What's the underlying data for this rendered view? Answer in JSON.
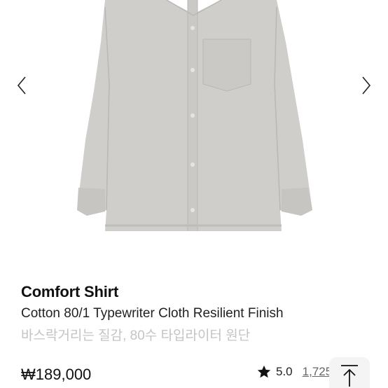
{
  "gallery": {
    "prev_icon": "chevron-left-icon",
    "next_icon": "chevron-right-icon",
    "image_alt": "grey shirt"
  },
  "product": {
    "name": "Comfort Shirt",
    "subtitle": "Cotton 80/1 Typewriter Cloth Resilient Finish",
    "description_kr": "바스락거리는 질감, 80수 타입라이터 원단",
    "price": "₩189,000"
  },
  "rating": {
    "score": "5.0",
    "review_count": "1,725",
    "icon": "star-icon"
  },
  "controls": {
    "scroll_top_icon": "arrow-up-icon"
  },
  "colors": {
    "shirt": "#cfcecb",
    "shirt_shadow": "#b9b8b4",
    "muted_text": "#c4c4c4"
  }
}
